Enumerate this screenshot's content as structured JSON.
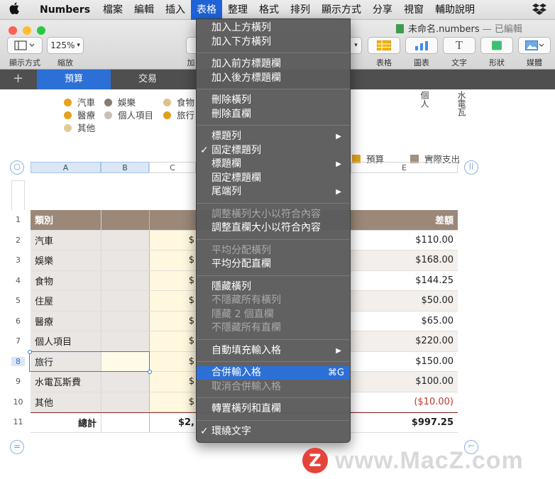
{
  "menubar": {
    "app_name": "Numbers",
    "items": [
      "檔案",
      "編輯",
      "插入",
      "表格",
      "整理",
      "格式",
      "排列",
      "顯示方式",
      "分享",
      "視窗",
      "輔助說明"
    ],
    "active_item": "表格"
  },
  "window": {
    "title": "未命名.numbers",
    "status": "— 已編輯",
    "colors": {
      "close": "#fd5f57",
      "minimize": "#febc2e",
      "zoom": "#28c840"
    }
  },
  "toolbar": {
    "view_label": "顯示方式",
    "zoom_value": "125%",
    "zoom_label": "縮放",
    "partial_label": "加",
    "table_label": "表格",
    "chart_label": "圖表",
    "text_label": "文字",
    "shape_label": "形狀",
    "media_label": "媒體"
  },
  "tabs": {
    "add": "+",
    "items": [
      "預算",
      "交易"
    ],
    "active": "預算"
  },
  "chart_legend": {
    "left": [
      {
        "label": "汽車",
        "color": "#e7a11b"
      },
      {
        "label": "娛樂",
        "color": "#8a7b72"
      },
      {
        "label": "食物",
        "color": "#dfc28a"
      },
      {
        "label": "醫療",
        "color": "#e7a11b"
      },
      {
        "label": "個人項目",
        "color": "#c9bfb5"
      },
      {
        "label": "旅行",
        "color": "#e0a01b"
      },
      {
        "label": "其他",
        "color": "#e2c99a"
      }
    ],
    "right": [
      {
        "label": "預算",
        "color": "#e3a21c"
      },
      {
        "label": "實際支出",
        "color": "#a18f80"
      }
    ],
    "vertical_labels": [
      "個人",
      "水電瓦"
    ]
  },
  "sheet": {
    "column_headers": [
      "A",
      "B",
      "C",
      "E"
    ],
    "row_numbers": [
      "1",
      "2",
      "3",
      "4",
      "5",
      "6",
      "7",
      "8",
      "9",
      "10",
      "11"
    ],
    "header_row": {
      "category": "類別",
      "diff": "差額"
    },
    "rows": [
      {
        "category": "汽車",
        "c": "$",
        "diff": "$110.00"
      },
      {
        "category": "娛樂",
        "c": "$",
        "diff": "$168.00"
      },
      {
        "category": "食物",
        "c": "$",
        "diff": "$144.25"
      },
      {
        "category": "住屋",
        "c": "$",
        "diff": "$50.00"
      },
      {
        "category": "醫療",
        "c": "$",
        "diff": "$65.00"
      },
      {
        "category": "個人項目",
        "c": "$",
        "diff": "$220.00"
      },
      {
        "category": "旅行",
        "c": "$",
        "diff": "$150.00"
      },
      {
        "category": "水電瓦斯費",
        "c": "$",
        "diff": "$100.00"
      },
      {
        "category": "其他",
        "c": "$",
        "diff": "($10.00)"
      }
    ],
    "total_row": {
      "label": "總計",
      "c": "$2,",
      "diff": "$997.25"
    },
    "colors": {
      "header_bg": "#9b8879",
      "negative": "#c0392b",
      "accent": "#2c6fd6"
    }
  },
  "table_menu": {
    "groups": [
      [
        {
          "label": "加入上方橫列"
        },
        {
          "label": "加入下方橫列"
        }
      ],
      [
        {
          "label": "加入前方標題欄"
        },
        {
          "label": "加入後方標題欄"
        }
      ],
      [
        {
          "label": "刪除橫列"
        },
        {
          "label": "刪除直欄"
        }
      ],
      [
        {
          "label": "標題列",
          "submenu": true
        },
        {
          "label": "固定標題列",
          "checked": true
        },
        {
          "label": "標題欄",
          "submenu": true
        },
        {
          "label": "固定標題欄"
        },
        {
          "label": "尾端列",
          "submenu": true
        }
      ],
      [
        {
          "label": "調整橫列大小以符合內容",
          "disabled": true
        },
        {
          "label": "調整直欄大小以符合內容"
        }
      ],
      [
        {
          "label": "平均分配橫列",
          "disabled": true
        },
        {
          "label": "平均分配直欄"
        }
      ],
      [
        {
          "label": "隱藏橫列"
        },
        {
          "label": "不隱藏所有橫列",
          "disabled": true
        },
        {
          "label": "隱藏 2 個直欄",
          "disabled": true
        },
        {
          "label": "不隱藏所有直欄",
          "disabled": true
        }
      ],
      [
        {
          "label": "自動填充輸入格",
          "submenu": true
        }
      ],
      [
        {
          "label": "合併輸入格",
          "shortcut": "⌘G",
          "highlighted": true
        },
        {
          "label": "取消合併輸入格",
          "disabled": true
        }
      ],
      [
        {
          "label": "轉置橫列和直欄"
        }
      ],
      [
        {
          "label": "環繞文字",
          "checked": true
        }
      ]
    ],
    "check_glyph": "✓",
    "arrow_glyph": "▶"
  },
  "watermark": {
    "logo": "Z",
    "text": "www.MacZ.com"
  }
}
